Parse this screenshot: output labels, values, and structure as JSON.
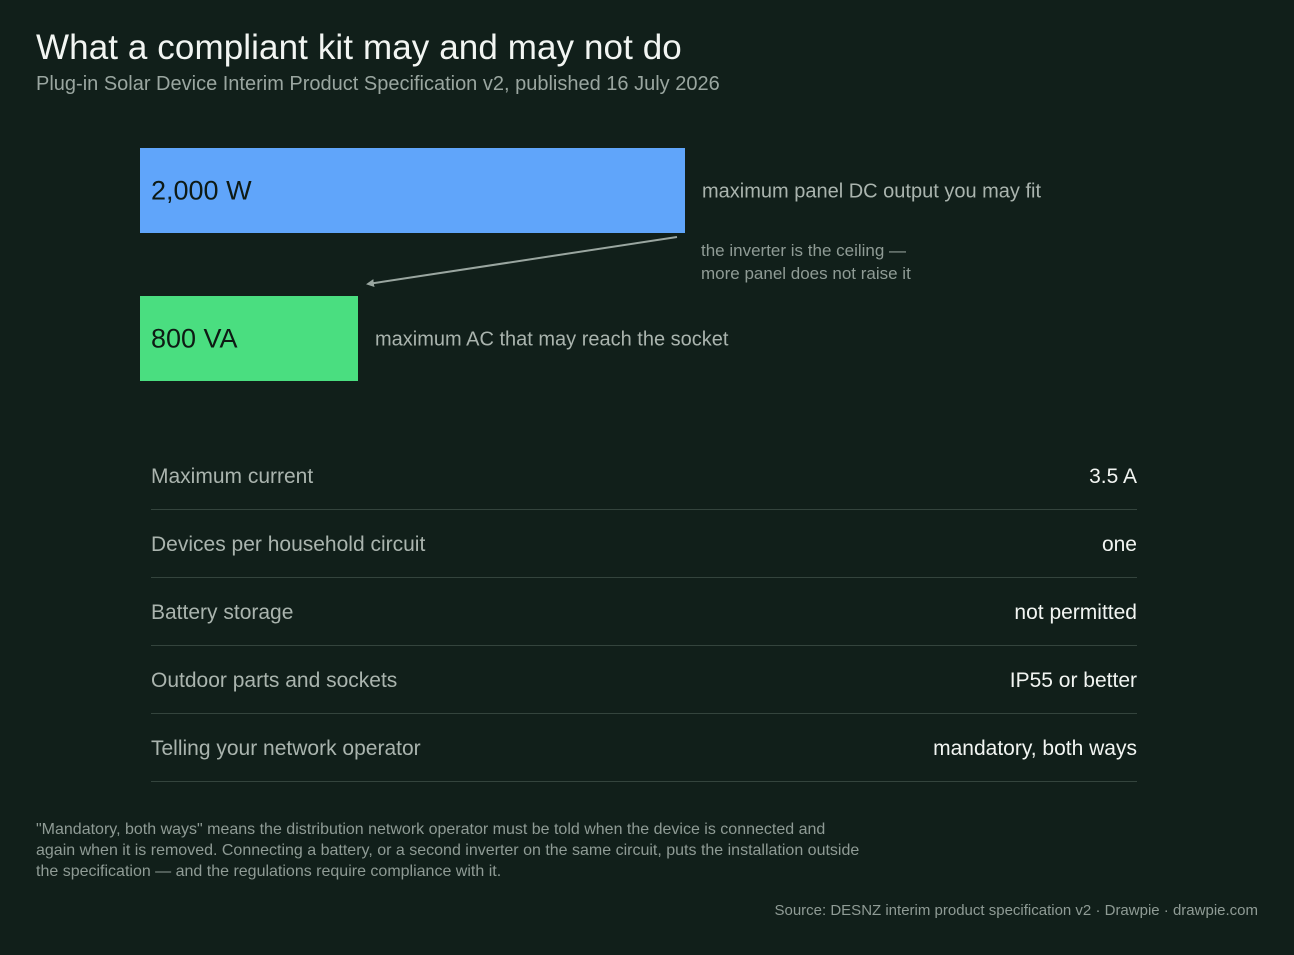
{
  "header": {
    "title": "What a compliant kit may and may not do",
    "subtitle": "Plug-in Solar Device Interim Product Specification v2, published 16 July 2026"
  },
  "colors": {
    "background": "#111f1a",
    "panel_bar": "#60a5fa",
    "ac_bar": "#4ade80",
    "arrow": "#9aa6a0"
  },
  "chart_data": {
    "type": "bar",
    "orientation": "horizontal",
    "categories": [
      "maximum panel DC output you may fit",
      "maximum AC that may reach the socket"
    ],
    "values": [
      2000,
      800
    ],
    "value_labels": [
      "2,000 W",
      "800 VA"
    ],
    "units": [
      "W",
      "VA"
    ],
    "colors": [
      "#60a5fa",
      "#4ade80"
    ],
    "annotation": {
      "lines": [
        "the inverter is the ceiling —",
        "more panel does not raise it"
      ],
      "from": "maximum panel DC output you may fit",
      "to": "maximum AC that may reach the socket"
    },
    "xlim": [
      0,
      2000
    ],
    "grid": false
  },
  "rules": [
    {
      "label": "Maximum current",
      "value": "3.5 A"
    },
    {
      "label": "Devices per household circuit",
      "value": "one"
    },
    {
      "label": "Battery storage",
      "value": "not permitted"
    },
    {
      "label": "Outdoor parts and sockets",
      "value": "IP55 or better"
    },
    {
      "label": "Telling your network operator",
      "value": "mandatory, both ways"
    }
  ],
  "footnote": "\"Mandatory, both ways\" means the distribution network operator must be told when the device is connected and again when it is removed. Connecting a battery, or a second inverter on the same circuit, puts the installation outside the specification — and the regulations require compliance with it.",
  "source": "Source: DESNZ interim product specification v2  ·  Drawpie · drawpie.com"
}
